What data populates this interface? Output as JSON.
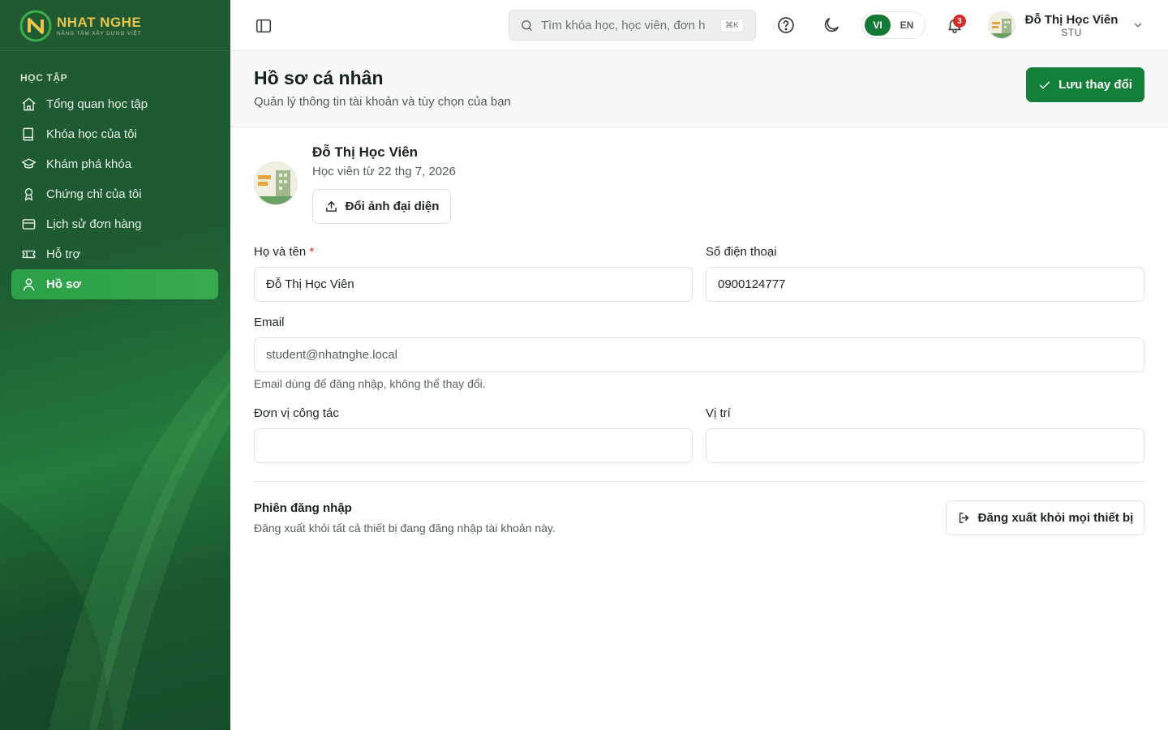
{
  "brand": {
    "name": "NHAT NGHE",
    "tagline": "NÂNG TẦM XÂY DỰNG VIỆT"
  },
  "sidebar": {
    "section_label": "HỌC TẬP",
    "items": [
      {
        "label": "Tổng quan học tập",
        "icon": "home-icon",
        "active": false
      },
      {
        "label": "Khóa học của tôi",
        "icon": "book-icon",
        "active": false
      },
      {
        "label": "Khám phá khóa",
        "icon": "graduation-cap-icon",
        "active": false
      },
      {
        "label": "Chứng chỉ của tôi",
        "icon": "award-icon",
        "active": false
      },
      {
        "label": "Lịch sử đơn hàng",
        "icon": "credit-card-icon",
        "active": false
      },
      {
        "label": "Hỗ trợ",
        "icon": "ticket-icon",
        "active": false
      },
      {
        "label": "Hồ sơ",
        "icon": "user-icon",
        "active": true
      }
    ]
  },
  "header": {
    "search_placeholder": "Tìm khóa học, học viên, đơn h",
    "search_shortcut": "⌘K",
    "lang_active": "VI",
    "lang_other": "EN",
    "notification_count": "3",
    "user_name": "Đỗ Thị Học Viên",
    "user_role": "STU"
  },
  "page": {
    "title": "Hồ sơ cá nhân",
    "subtitle": "Quản lý thông tin tài khoản và tùy chọn của bạn",
    "save_label": "Lưu thay đổi"
  },
  "profile": {
    "name": "Đỗ Thị Học Viên",
    "member_since": "Học viên từ 22 thg 7, 2026",
    "change_avatar_label": "Đổi ảnh đại diện"
  },
  "form": {
    "fullname_label": "Họ và tên",
    "fullname_required": "*",
    "fullname_value": "Đỗ Thị Học Viên",
    "phone_label": "Số điện thoại",
    "phone_value": "0900124777",
    "email_label": "Email",
    "email_value": "student@nhatnghe.local",
    "email_hint": "Email dùng để đăng nhập, không thể thay đổi.",
    "org_label": "Đơn vị công tác",
    "org_value": "",
    "position_label": "Vị trí",
    "position_value": ""
  },
  "session": {
    "title": "Phiên đăng nhập",
    "description": "Đăng xuất khỏi tất cả thiết bị đang đăng nhập tài khoản này.",
    "logout_all_label": "Đăng xuất khỏi mọi thiết bị"
  },
  "colors": {
    "primary": "#13803a",
    "sidebar": "#1f5a33",
    "active_nav": "#2ba048",
    "danger": "#d62b2b",
    "logo_gold": "#e8c44a"
  }
}
